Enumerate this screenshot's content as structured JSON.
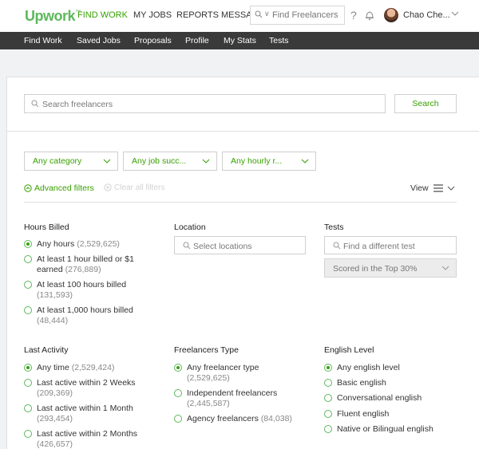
{
  "header": {
    "logo": "Upwork",
    "logo_tm": "™",
    "nav": [
      "FIND WORK",
      "MY JOBS",
      "REPORTS",
      "MESSAGES"
    ],
    "search_placeholder": "Find Freelancers",
    "help": "?",
    "username": "Chao Che..."
  },
  "subnav": [
    "Find Work",
    "Saved Jobs",
    "Proposals",
    "Profile",
    "My Stats",
    "Tests"
  ],
  "search": {
    "placeholder": "Search freelancers",
    "button": "Search"
  },
  "dropdowns": [
    "Any category",
    "Any job succ...",
    "Any hourly r..."
  ],
  "filters": {
    "advanced": "Advanced filters",
    "clear": "Clear all filters",
    "view": "View"
  },
  "hours_billed": {
    "title": "Hours Billed",
    "options": [
      {
        "label": "Any hours",
        "count": "(2,529,625)"
      },
      {
        "label": "At least 1 hour billed or $1",
        "label2": "earned",
        "count": "(276,889)"
      },
      {
        "label": "At least 100 hours billed",
        "count": "(131,593)"
      },
      {
        "label": "At least 1,000 hours billed",
        "count": "(48,444)"
      }
    ]
  },
  "location": {
    "title": "Location",
    "placeholder": "Select locations"
  },
  "tests": {
    "title": "Tests",
    "placeholder": "Find a different test",
    "score": "Scored in the Top 30%"
  },
  "last_activity": {
    "title": "Last Activity",
    "options": [
      {
        "label": "Any time",
        "count": "(2,529,424)"
      },
      {
        "label": "Last active within 2 Weeks",
        "count": "(209,369)"
      },
      {
        "label": "Last active within 1 Month",
        "count": "(293,454)"
      },
      {
        "label": "Last active within 2 Months",
        "count": "(426,657)"
      }
    ]
  },
  "freelancers_type": {
    "title": "Freelancers Type",
    "options": [
      {
        "label": "Any freelancer type",
        "count": "(2,529,625)"
      },
      {
        "label": "Independent freelancers",
        "count": "(2,445,587)"
      },
      {
        "label": "Agency freelancers",
        "count": "(84,038)"
      }
    ]
  },
  "english_level": {
    "title": "English Level",
    "options": [
      {
        "label": "Any english level"
      },
      {
        "label": "Basic english"
      },
      {
        "label": "Conversational english"
      },
      {
        "label": "Fluent english"
      },
      {
        "label": "Native or Bilingual english"
      }
    ]
  },
  "colors": {
    "brand": "#37a000",
    "subnav_bg": "#3a3a3a"
  }
}
